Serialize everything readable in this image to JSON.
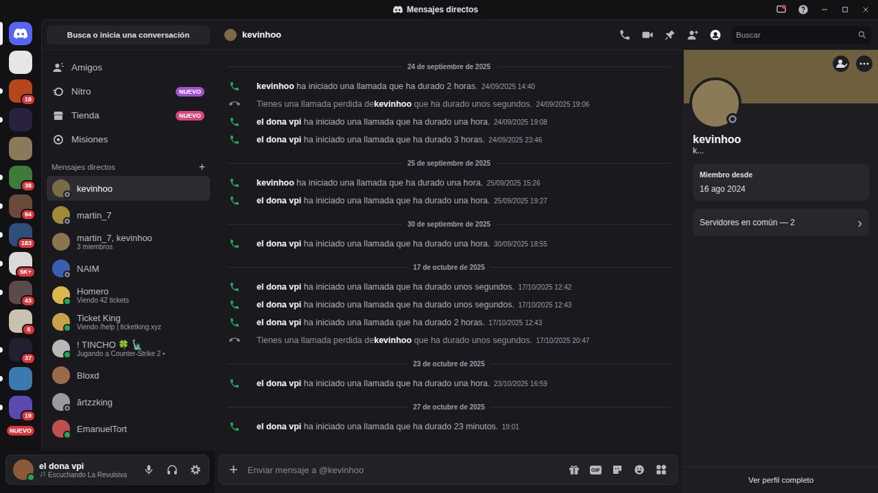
{
  "window": {
    "title": "Mensajes directos"
  },
  "rail": {
    "home": {
      "selected": true
    },
    "servers": [
      {
        "color": "#e6e6e6",
        "badge": "",
        "unread": false
      },
      {
        "color": "#b5461c",
        "badge": "18",
        "unread": true
      },
      {
        "color": "#2a2140",
        "badge": "",
        "unread": true
      },
      {
        "color": "#8a7a5a",
        "badge": "",
        "unread": false
      },
      {
        "color": "#3f7a3a",
        "badge": "38",
        "unread": true
      },
      {
        "color": "#6a4a3a",
        "badge": "94",
        "unread": true
      },
      {
        "color": "#2f4f7a",
        "badge": "183",
        "unread": true
      },
      {
        "color": "#d9d9d9",
        "badge": "5K+",
        "unread": true
      },
      {
        "color": "#5a4a4a",
        "badge": "43",
        "unread": true
      },
      {
        "color": "#c9c2b0",
        "badge": "6",
        "unread": false
      },
      {
        "color": "#202030",
        "badge": "37",
        "unread": true
      },
      {
        "color": "#3a7ab0",
        "badge": "",
        "unread": true
      },
      {
        "color": "#5a4ab0",
        "badge": "19",
        "unread": true
      }
    ],
    "new_label": "NUEVO"
  },
  "sidebar": {
    "search": "Busca o inicia una conversación",
    "nav": [
      {
        "kind": "friends",
        "label": "Amigos",
        "badge": "",
        "badge_color": ""
      },
      {
        "kind": "nitro",
        "label": "Nitro",
        "badge": "NUEVO",
        "badge_color": "#a24fd0"
      },
      {
        "kind": "shop",
        "label": "Tienda",
        "badge": "NUEVO",
        "badge_color": "#d9447a"
      },
      {
        "kind": "missions",
        "label": "Misiones",
        "badge": "",
        "badge_color": ""
      }
    ],
    "dm_header": "Mensajes directos",
    "dm_add": "+",
    "dms": [
      {
        "name": "kevinhoo",
        "sub": "",
        "status": "offline",
        "selected": true,
        "color": "#7a6a45"
      },
      {
        "name": "martin_7",
        "sub": "",
        "status": "offline",
        "selected": false,
        "color": "#a08a3a"
      },
      {
        "name": "martin_7, kevinhoo",
        "sub": "3 miembros",
        "status": "none",
        "selected": false,
        "color": "#8a7550"
      },
      {
        "name": "NAIM",
        "sub": "",
        "status": "offline",
        "selected": false,
        "color": "#3a5fb0"
      },
      {
        "name": "Homero",
        "sub": "Viendo 42 tickets",
        "status": "online",
        "selected": false,
        "color": "#d8b84a"
      },
      {
        "name": "Ticket King",
        "sub": "Viendo /help | ticketking.xyz",
        "status": "online",
        "selected": false,
        "color": "#c9a04a"
      },
      {
        "name": "! TINCHO 🍀 🗽",
        "sub": "Jugando a Counter-Strike 2 •",
        "status": "online",
        "selected": false,
        "color": "#b8b8b8"
      },
      {
        "name": "Bloxd",
        "sub": "",
        "status": "none",
        "selected": false,
        "color": "#9a6a4a"
      },
      {
        "name": "ărtzzking",
        "sub": "",
        "status": "offline",
        "selected": false,
        "color": "#9a9a9a"
      },
      {
        "name": "EmanuelTort",
        "sub": "",
        "status": "online",
        "selected": false,
        "color": "#c05050"
      }
    ]
  },
  "user": {
    "name": "el dona vpi",
    "activity": "Escuchando La Revulsiva"
  },
  "chat": {
    "title": "kevinhoo",
    "search": "Buscar",
    "days": [
      {
        "date": "24 de septiembre de 2025",
        "events": [
          {
            "kind": "call",
            "before": "",
            "name": "kevinhoo",
            "after": "ha iniciado una llamada que ha durado 2 horas.",
            "time": "24/09/2025 14:40"
          },
          {
            "kind": "missed",
            "before": "Tienes una llamada perdida de",
            "name": "kevinhoo",
            "after": "que ha durado unos segundos.",
            "time": "24/09/2025 19:06"
          },
          {
            "kind": "call",
            "before": "",
            "name": "el dona vpi",
            "after": "ha iniciado una llamada que ha durado una hora.",
            "time": "24/09/2025 19:08"
          },
          {
            "kind": "call",
            "before": "",
            "name": "el dona vpi",
            "after": "ha iniciado una llamada que ha durado 3 horas.",
            "time": "24/09/2025 23:46"
          }
        ]
      },
      {
        "date": "25 de septiembre de 2025",
        "events": [
          {
            "kind": "call",
            "before": "",
            "name": "kevinhoo",
            "after": "ha iniciado una llamada que ha durado una hora.",
            "time": "25/09/2025 15:26"
          },
          {
            "kind": "call",
            "before": "",
            "name": "el dona vpi",
            "after": "ha iniciado una llamada que ha durado una hora.",
            "time": "25/09/2025 19:27"
          }
        ]
      },
      {
        "date": "30 de septiembre de 2025",
        "events": [
          {
            "kind": "call",
            "before": "",
            "name": "el dona vpi",
            "after": "ha iniciado una llamada que ha durado una hora.",
            "time": "30/09/2025 18:55"
          }
        ]
      },
      {
        "date": "17 de octubre de 2025",
        "events": [
          {
            "kind": "call",
            "before": "",
            "name": "el dona vpi",
            "after": "ha iniciado una llamada que ha durado unos segundos.",
            "time": "17/10/2025 12:42"
          },
          {
            "kind": "call",
            "before": "",
            "name": "el dona vpi",
            "after": "ha iniciado una llamada que ha durado unos segundos.",
            "time": "17/10/2025 12:43"
          },
          {
            "kind": "call",
            "before": "",
            "name": "el dona vpi",
            "after": "ha iniciado una llamada que ha durado 2 horas.",
            "time": "17/10/2025 12:43"
          },
          {
            "kind": "missed",
            "before": "Tienes una llamada perdida de",
            "name": "kevinhoo",
            "after": "que ha durado unos segundos.",
            "time": "17/10/2025 20:47"
          }
        ]
      },
      {
        "date": "23 de octubre de 2025",
        "events": [
          {
            "kind": "call",
            "before": "",
            "name": "el dona vpi",
            "after": "ha iniciado una llamada que ha durado una hora.",
            "time": "23/10/2025 16:59"
          }
        ]
      },
      {
        "date": "27 de octubre de 2025",
        "events": [
          {
            "kind": "call",
            "before": "",
            "name": "el dona vpi",
            "after": "ha iniciado una llamada que ha durado 23 minutos.",
            "time": "19:01"
          }
        ]
      }
    ],
    "composer": {
      "placeholder": "Enviar mensaje a @kevinhoo",
      "add": "+",
      "gif": "GIF"
    }
  },
  "profile": {
    "name": "kevinhoo",
    "status": "k...",
    "status_dot": "offline",
    "member_label": "Miembro desde",
    "member_since": "16 ago 2024",
    "common_servers": "Servidores en común — 2",
    "chevron": "›",
    "full_profile": "Ver perfil completo"
  }
}
